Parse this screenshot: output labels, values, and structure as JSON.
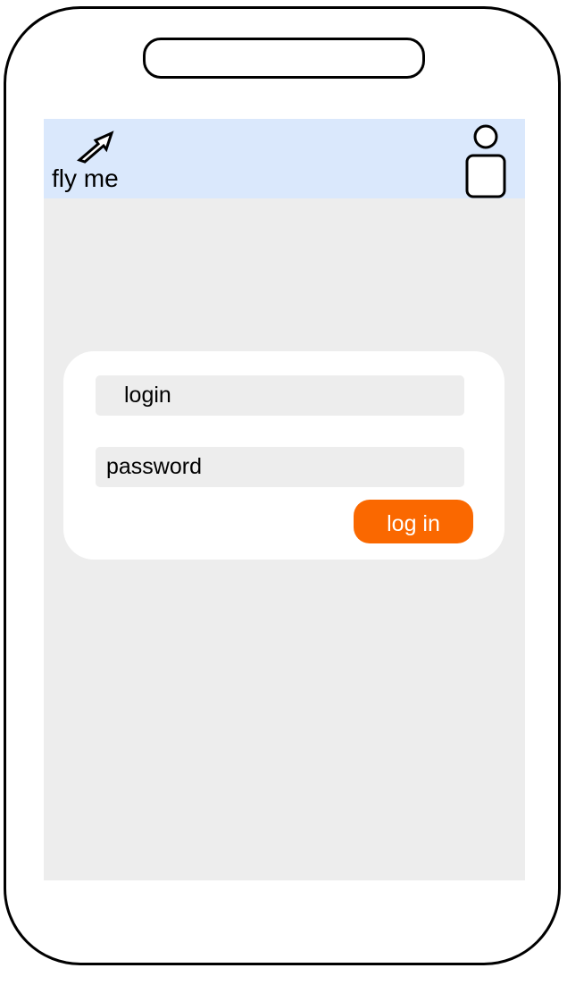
{
  "header": {
    "app_title": "fly me",
    "logo_icon": "arrow-up-right-icon",
    "user_icon": "user-avatar-icon",
    "background_color": "#dae8fc"
  },
  "login_form": {
    "login_field_value": "login",
    "password_field_value": "password",
    "submit_label": "log in",
    "submit_color": "#fa6800"
  },
  "colors": {
    "screen_background": "#ededed",
    "card_background": "#ffffff",
    "frame_stroke": "#000000"
  }
}
